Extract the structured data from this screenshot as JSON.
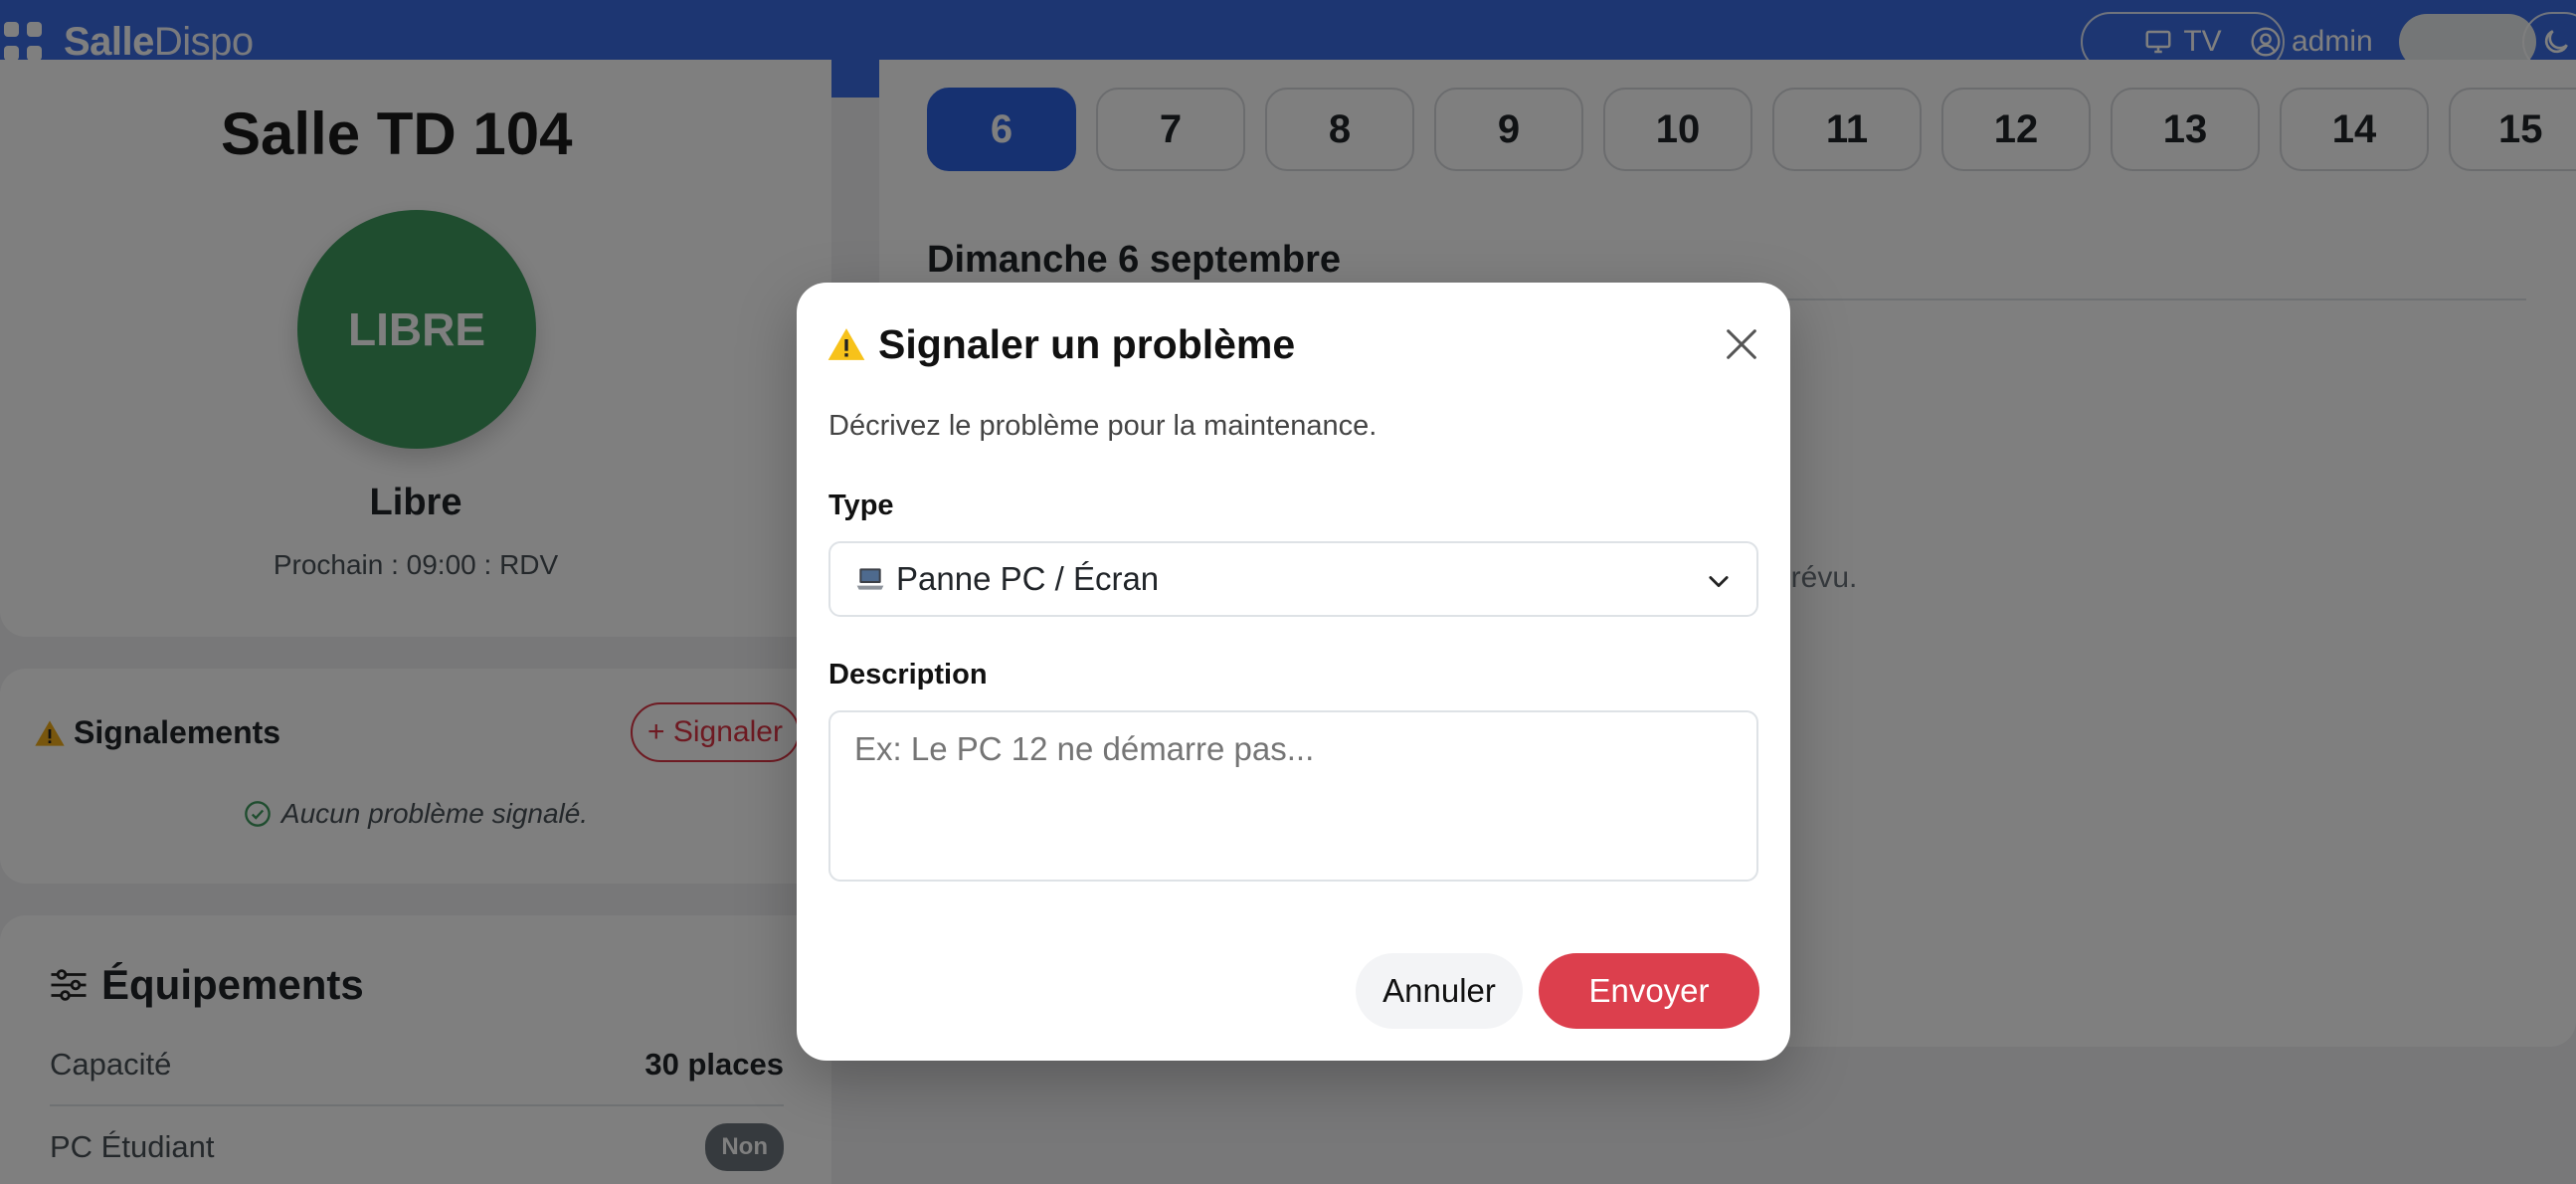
{
  "navbar": {
    "brand_bold": "Salle",
    "brand_light": "Dispo",
    "tv_label": "TV",
    "user_label": "admin"
  },
  "status_card": {
    "room_title": "Salle TD 104",
    "status_badge": "LIBRE",
    "status_label": "Libre",
    "next_text": "Prochain : 09:00 : RDV"
  },
  "reports": {
    "title": "Signalements",
    "add_button": "+ Signaler",
    "empty_text": "Aucun problème signalé."
  },
  "equipment": {
    "title": "Équipements",
    "rows": [
      {
        "label": "Capacité",
        "value": "30 places"
      },
      {
        "label": "PC Étudiant",
        "value": "Non"
      }
    ]
  },
  "calendar": {
    "days": [
      "6",
      "7",
      "8",
      "9",
      "10",
      "11",
      "12",
      "13",
      "14",
      "15"
    ],
    "active_day": "6",
    "date_heading": "Dimanche 6 septembre",
    "empty_text_fragment": "prévu."
  },
  "modal": {
    "title": "Signaler un problème",
    "description": "Décrivez le problème pour la maintenance.",
    "type_label": "Type",
    "type_value": "Panne PC / Écran",
    "description_label": "Description",
    "description_placeholder": "Ex: Le PC 12 ne démarre pas...",
    "cancel_label": "Annuler",
    "send_label": "Envoyer"
  },
  "colors": {
    "navbar": "#3a6ce4",
    "status_free": "#3f9a5e",
    "active_day": "#2d63e2",
    "danger": "#dc3f4d"
  },
  "icons": [
    "apps-icon",
    "tv-icon",
    "user-icon",
    "moon-icon",
    "warning-icon",
    "check-circle-icon",
    "sliders-icon",
    "laptop-icon",
    "chevron-down-icon",
    "close-icon"
  ]
}
